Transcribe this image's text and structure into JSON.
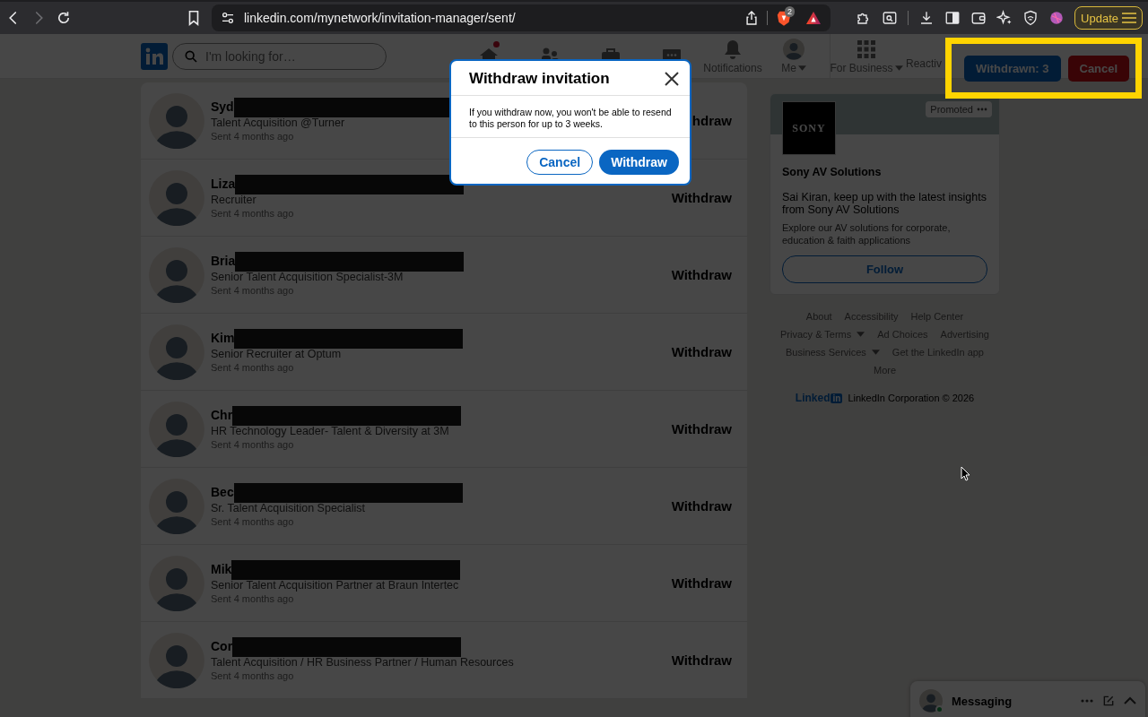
{
  "browser": {
    "nav_buttons": [
      {
        "kind": "back",
        "disabled": false
      },
      {
        "kind": "forward",
        "disabled": true
      },
      {
        "kind": "reload",
        "disabled": false
      }
    ],
    "url": "linkedin.com/mynetwork/invitation-manager/sent/",
    "shields_badge": "2",
    "update_label": "Update"
  },
  "header": {
    "search": {
      "placeholder": "I'm looking for…"
    },
    "nav": [
      {
        "kind": "home",
        "has_badge": true,
        "has_menu": false
      },
      {
        "kind": "network",
        "has_badge": false,
        "has_menu": false
      },
      {
        "kind": "jobs",
        "has_badge": false,
        "has_menu": false
      },
      {
        "kind": "messaging",
        "has_badge": false,
        "has_menu": false
      },
      {
        "kind": "notifications",
        "label": "Notifications",
        "has_badge": false,
        "has_menu": false
      },
      {
        "kind": "me",
        "label": "Me",
        "has_badge": false,
        "has_menu": true
      },
      {
        "kind": "business",
        "label": "For Business",
        "has_badge": false,
        "has_menu": true
      },
      {
        "kind": "text",
        "label": "Reactiv",
        "has_badge": false,
        "has_menu": false
      }
    ]
  },
  "invitations": [
    {
      "name": "Syd",
      "headline": "Talent Acquisition @Turner",
      "sent": "Sent 4 months ago",
      "action": "hdraw"
    },
    {
      "name": "Liza",
      "headline": "Recruiter",
      "sent": "Sent 4 months ago",
      "action": "Withdraw"
    },
    {
      "name": "Bria",
      "headline": "Senior Talent Acquisition Specialist-3M",
      "sent": "Sent 4 months ago",
      "action": "Withdraw"
    },
    {
      "name": "Kim",
      "headline": "Senior Recruiter at Optum",
      "sent": "Sent 4 months ago",
      "action": "Withdraw"
    },
    {
      "name": "Chr",
      "headline": "HR Technology Leader- Talent & Diversity at 3M",
      "sent": "Sent 4 months ago",
      "action": "Withdraw"
    },
    {
      "name": "Bec",
      "headline": "Sr. Talent Acquisition Specialist",
      "sent": "Sent 4 months ago",
      "action": "Withdraw"
    },
    {
      "name": "Mik",
      "headline": "Senior Talent Acquisition Partner at Braun Intertec",
      "sent": "Sent 4 months ago",
      "action": "Withdraw"
    },
    {
      "name": "Cor",
      "headline": "Talent Acquisition / HR Business Partner / Human Resources",
      "sent": "Sent 4 months ago",
      "action": "Withdraw"
    }
  ],
  "ad": {
    "label": "Promoted",
    "logo_text": "SONY",
    "company": "Sony AV Solutions",
    "headline": "Sai Kiran, keep up with the latest insights from Sony AV Solutions",
    "description": "Explore our AV solutions for corporate, education & faith applications",
    "button": "Follow"
  },
  "footer": {
    "link_rows": [
      [
        {
          "label": "About",
          "has_menu": false
        },
        {
          "label": "Accessibility",
          "has_menu": false
        },
        {
          "label": "Help Center",
          "has_menu": false
        }
      ],
      [
        {
          "label": "Privacy & Terms",
          "has_menu": true
        },
        {
          "label": "Ad Choices",
          "has_menu": false
        },
        {
          "label": "Advertising",
          "has_menu": false
        }
      ],
      [
        {
          "label": "Business Services",
          "has_menu": true
        },
        {
          "label": "Get the LinkedIn app",
          "has_menu": false
        }
      ],
      [
        {
          "label": "More",
          "has_menu": false
        }
      ]
    ],
    "logo_word": "Linked",
    "logo_mark": "in",
    "copyright": "LinkedIn Corporation © 2026"
  },
  "dialog": {
    "title": "Withdraw invitation",
    "message": "If you withdraw now, you won't be able to resend to this person for up to 3 weeks.",
    "buttons": [
      {
        "label": "Cancel",
        "kind": "secondary"
      },
      {
        "label": "Withdraw",
        "kind": "primary"
      }
    ]
  },
  "annotation": {
    "buttons": [
      {
        "label": "Withdrawn: 3",
        "kind": "primary"
      },
      {
        "label": "Cancel",
        "kind": "danger"
      }
    ]
  },
  "messaging": {
    "title": "Messaging",
    "online": true
  }
}
